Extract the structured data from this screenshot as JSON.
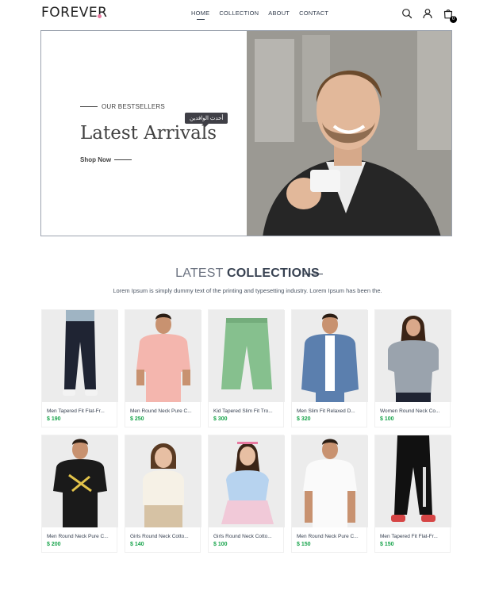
{
  "brand": {
    "logo_text": "FOREVER",
    "dot_color": "#e879a0"
  },
  "nav": {
    "links": [
      "HOME",
      "COLLECTION",
      "ABOUT",
      "CONTACT"
    ],
    "active": "HOME",
    "icons": [
      "search-icon",
      "profile-icon",
      "cart-icon"
    ],
    "cart_count": "0"
  },
  "hero": {
    "eyebrow": "OUR BESTSELLERS",
    "title": "Latest Arrivals",
    "cta": "Shop Now",
    "tooltip": "أحدث الوافدين"
  },
  "collections": {
    "title_light": "LATEST",
    "title_bold": "COLLECTIONS",
    "subtitle": "Lorem Ipsum is simply dummy text of the printing and typesetting industry. Lorem Ipsum has been the."
  },
  "products": [
    {
      "name": "Men Tapered Fit Flat-Fr...",
      "price": "$ 190"
    },
    {
      "name": "Men Round Neck Pure C...",
      "price": "$ 250"
    },
    {
      "name": "Kid Tapered Slim Fit Tro...",
      "price": "$ 300"
    },
    {
      "name": "Men Slim Fit Relaxed D...",
      "price": "$ 320"
    },
    {
      "name": "Women Round Neck Co...",
      "price": "$ 100"
    },
    {
      "name": "Men Round Neck Pure C...",
      "price": "$ 200"
    },
    {
      "name": "Girls Round Neck Cotto...",
      "price": "$ 140"
    },
    {
      "name": "Girls Round Neck Cotto...",
      "price": "$ 100"
    },
    {
      "name": "Men Round Neck Pure C...",
      "price": "$ 150"
    },
    {
      "name": "Men Tapered Fit Flat-Fr...",
      "price": "$ 150"
    }
  ],
  "colors": {
    "price": "#16a34a",
    "text": "#374151",
    "card_bg": "#ececec"
  }
}
